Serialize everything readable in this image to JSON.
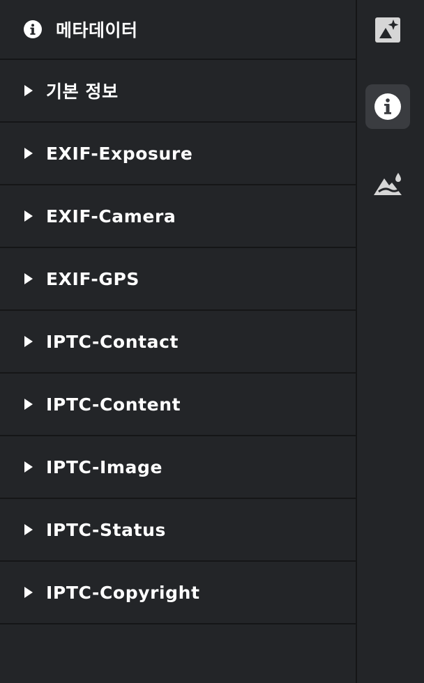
{
  "panel": {
    "title": "메타데이터",
    "title_icon": "info-icon",
    "sections": [
      {
        "label": "기본 정보"
      },
      {
        "label": "EXIF-Exposure"
      },
      {
        "label": "EXIF-Camera"
      },
      {
        "label": "EXIF-GPS"
      },
      {
        "label": "IPTC-Contact"
      },
      {
        "label": "IPTC-Content"
      },
      {
        "label": "IPTC-Image"
      },
      {
        "label": "IPTC-Status"
      },
      {
        "label": "IPTC-Copyright"
      }
    ]
  },
  "rail": {
    "buttons": [
      {
        "icon": "image-sparkle-icon",
        "active": false
      },
      {
        "icon": "info-icon",
        "active": true
      },
      {
        "icon": "mountain-drop-icon",
        "active": false
      }
    ]
  },
  "colors": {
    "background": "#232528",
    "divider": "#151617",
    "active_button": "#3a3c40",
    "text": "#ffffff",
    "icon": "#d6d6d6"
  }
}
